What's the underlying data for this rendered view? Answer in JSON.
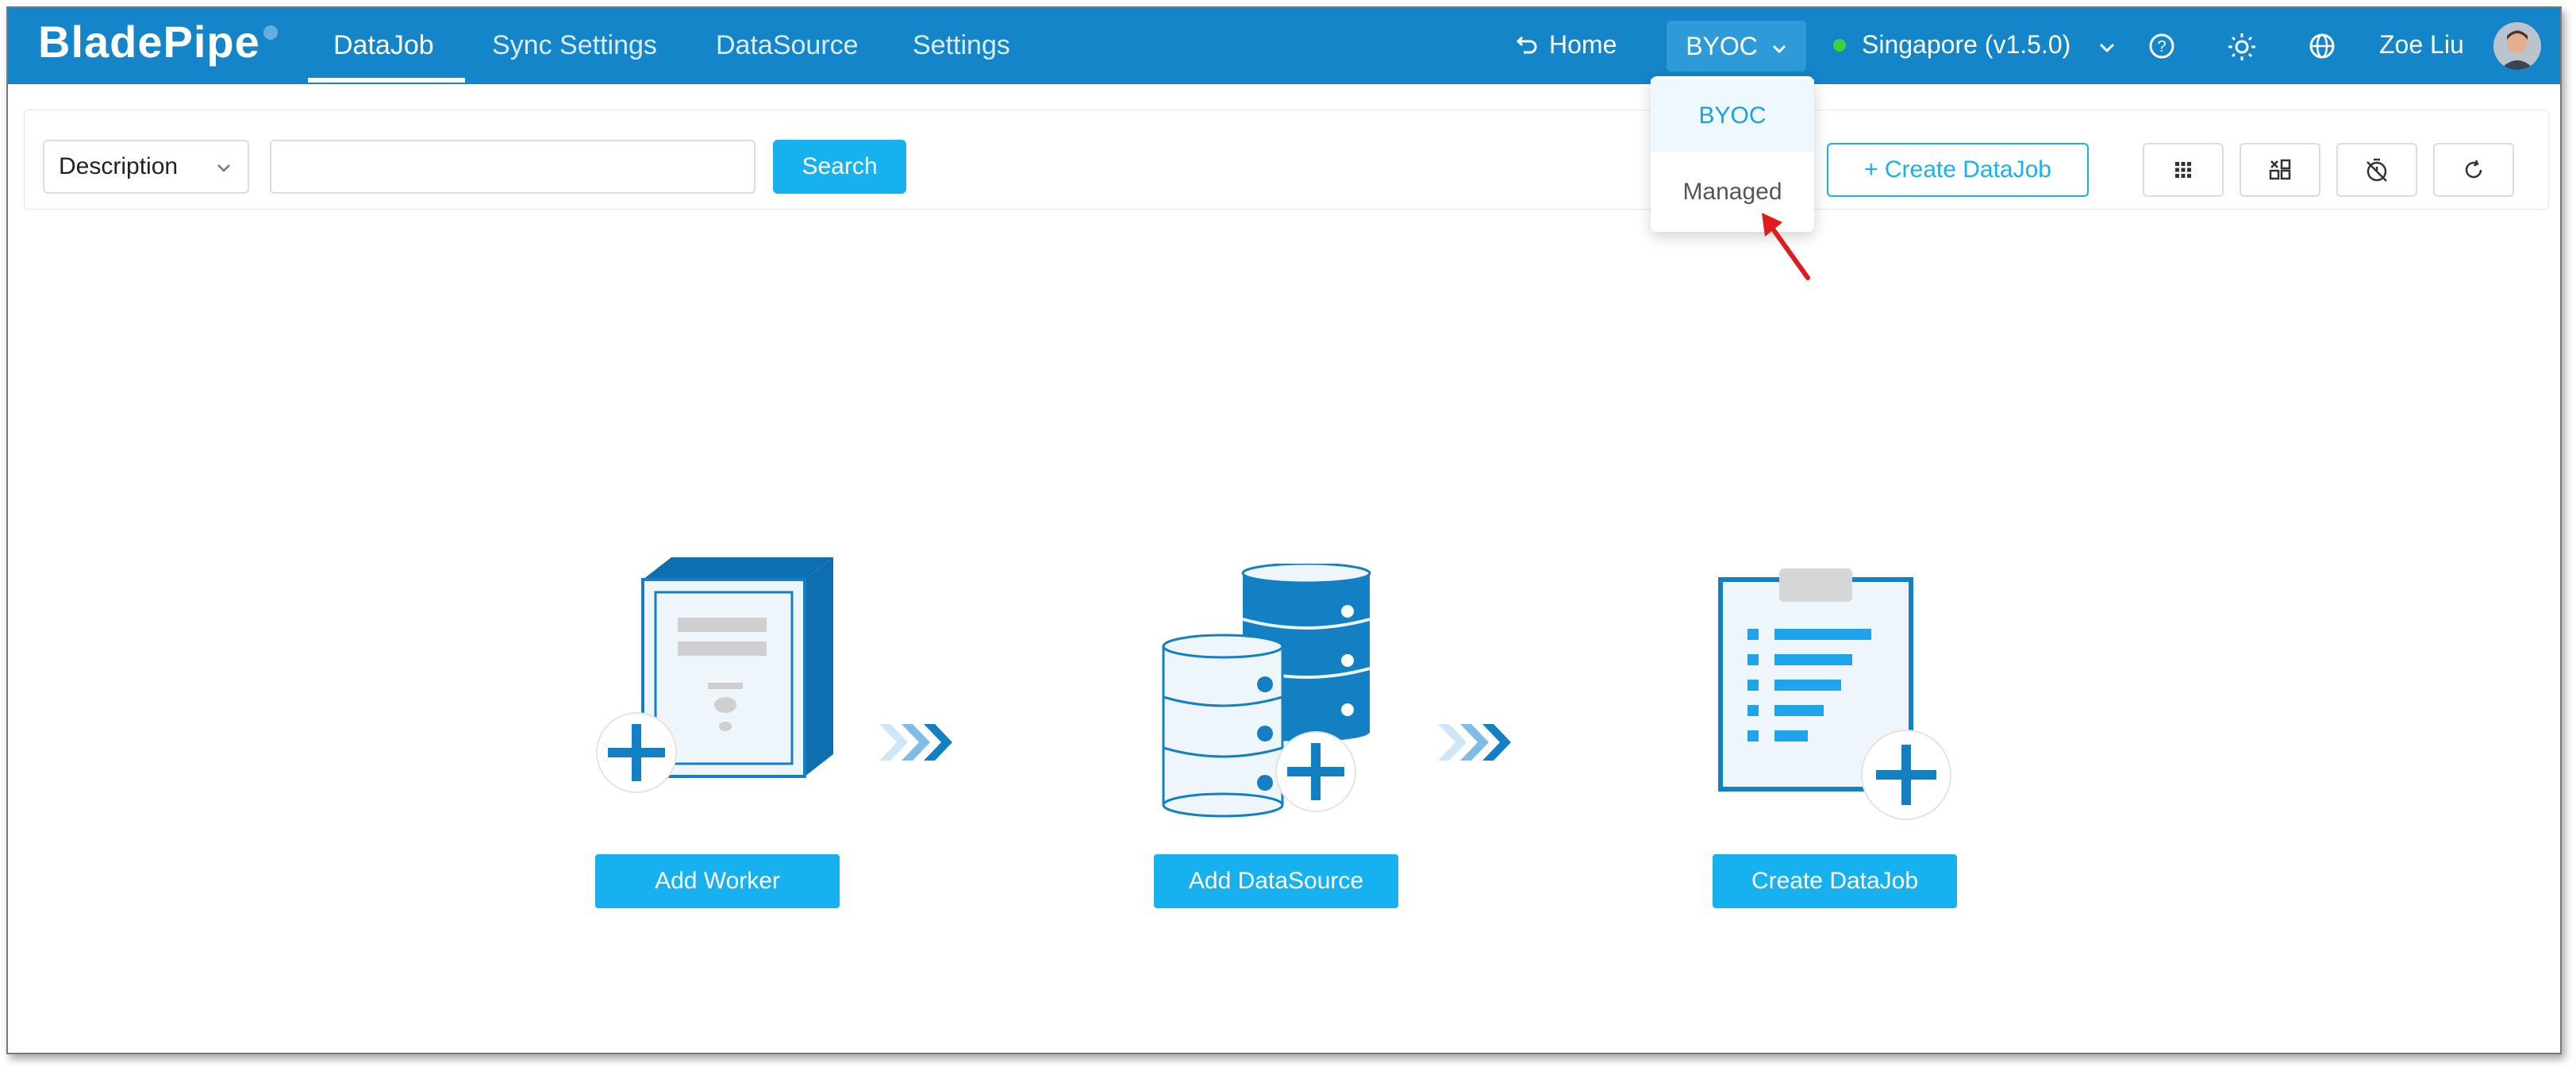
{
  "header": {
    "logo": "BladePipe",
    "nav": [
      {
        "label": "DataJob",
        "active": true
      },
      {
        "label": "Sync Settings",
        "active": false
      },
      {
        "label": "DataSource",
        "active": false
      },
      {
        "label": "Settings",
        "active": false
      }
    ],
    "home_label": "Home",
    "deploy_mode": "BYOC",
    "region_label": "Singapore (v1.5.0)",
    "user_name": "Zoe Liu"
  },
  "deploy_menu": {
    "options": [
      "BYOC",
      "Managed"
    ],
    "selected": "BYOC"
  },
  "toolbar": {
    "filter_select": "Description",
    "search_value": "",
    "search_button": "Search",
    "create_button": "+ Create DataJob"
  },
  "steps": [
    {
      "button": "Add Worker",
      "icon": "server-add-icon"
    },
    {
      "button": "Add DataSource",
      "icon": "database-add-icon"
    },
    {
      "button": "Create DataJob",
      "icon": "clipboard-add-icon"
    }
  ],
  "colors": {
    "header_bg": "#1485c9",
    "accent": "#17b1ef",
    "illustration_blue": "#1480c4",
    "status_online": "#3ed13e",
    "annotation_arrow": "#e01b1b"
  }
}
